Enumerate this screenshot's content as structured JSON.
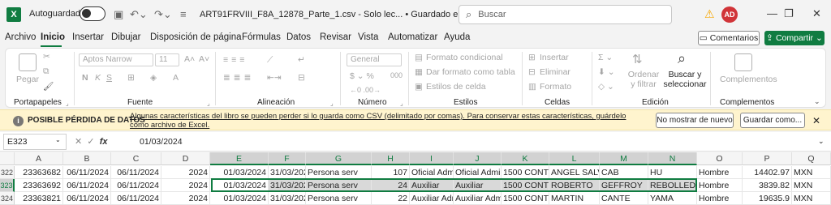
{
  "title_bar": {
    "app_icon": "X",
    "autosave_label": "Autoguardado",
    "doc_title": "ART91FRVIII_F8A_12878_Parte_1.csv  -  Solo lec...  •  Guardado en Este PC  ⌄",
    "search_placeholder": "Buscar",
    "avatar": "AD"
  },
  "tabs": [
    "Archivo",
    "Inicio",
    "Insertar",
    "Dibujar",
    "Disposición de página",
    "Fórmulas",
    "Datos",
    "Revisar",
    "Vista",
    "Automatizar",
    "Ayuda"
  ],
  "buttons": {
    "comments": "Comentarios",
    "share": "Compartir"
  },
  "ribbon": {
    "groups": [
      "Portapapeles",
      "Fuente",
      "Alineación",
      "Número",
      "Estilos",
      "Celdas",
      "Edición",
      "Complementos"
    ],
    "paste": "Pegar",
    "font_name": "Aptos Narrow",
    "font_size": "11",
    "number_format": "General",
    "styles": [
      "Formato condicional",
      "Dar formato como tabla",
      "Estilos de celda"
    ],
    "cells": [
      "Insertar",
      "Eliminar",
      "Formato"
    ],
    "sort_filter": "Ordenar y filtrar",
    "find_select": "Buscar y seleccionar",
    "addins": "Complementos"
  },
  "infobar": {
    "title": "POSIBLE PÉRDIDA DE DATOS",
    "message": "Algunas características del libro se pueden perder si lo guarda como CSV (delimitado por comas). Para conservar estas características, guárdelo como archivo de Excel.",
    "dont_show": "No mostrar de nuevo",
    "save_as": "Guardar como..."
  },
  "formula_bar": {
    "name_box": "E323",
    "fx": "fx",
    "value": "01/03/2024"
  },
  "grid": {
    "columns": [
      "A",
      "B",
      "C",
      "D",
      "E",
      "F",
      "G",
      "H",
      "I",
      "J",
      "K",
      "L",
      "M",
      "N",
      "O",
      "P",
      "Q"
    ],
    "selected_columns": [
      "E",
      "F",
      "G",
      "H",
      "I",
      "J",
      "K",
      "L",
      "M",
      "N"
    ],
    "rows": [
      {
        "num": "322",
        "selected": false,
        "cells": [
          "23363682",
          "06/11/2024",
          "06/11/2024",
          "2024",
          "01/03/2024",
          "31/03/2024",
          "Persona serv",
          "107",
          "Oficial Admi",
          "Oficial Admi",
          "1500 CONTR/",
          "ANGEL SALVA",
          "CAB",
          "HU",
          "Hombre",
          "14402.97",
          "MXN"
        ]
      },
      {
        "num": "323",
        "selected": true,
        "cells": [
          "23363692",
          "06/11/2024",
          "06/11/2024",
          "2024",
          "01/03/2024",
          "31/03/2024",
          "Persona serv",
          "24",
          "Auxiliar",
          "Auxiliar",
          "1500 CONTR/",
          "ROBERTO",
          "GEFFROY",
          "REBOLLEDO",
          "Hombre",
          "3839.82",
          "MXN"
        ]
      },
      {
        "num": "324",
        "selected": false,
        "cells": [
          "23363821",
          "06/11/2024",
          "06/11/2024",
          "2024",
          "01/03/2024",
          "31/03/2024",
          "Persona serv",
          "22",
          "Auxiliar Adm",
          "Auxiliar Adm",
          "1500 CONTR/",
          "MARTIN",
          "CANTE",
          "YAMA",
          "Hombre",
          "19635.9",
          "MXN"
        ]
      }
    ]
  },
  "colors": {
    "accent": "#107c41",
    "info_bg": "#fff4ce"
  }
}
